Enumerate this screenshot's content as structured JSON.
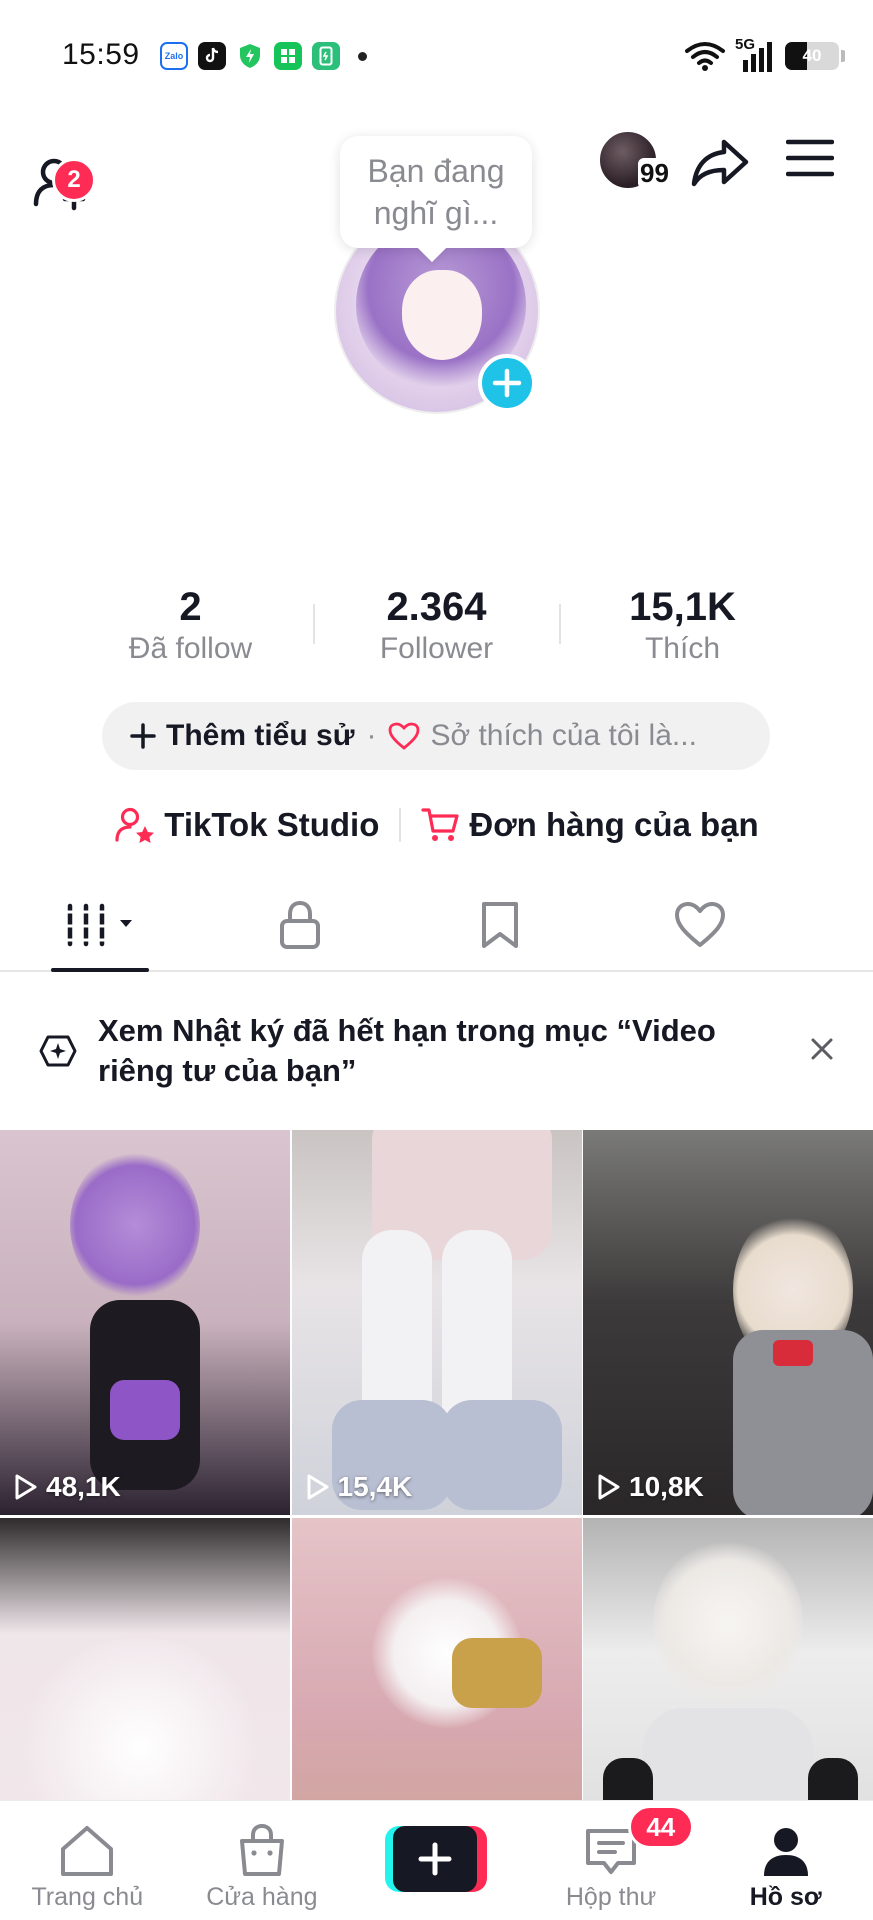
{
  "status_bar": {
    "time": "15:59",
    "network": "5G",
    "battery": "40",
    "notification_icons": [
      "zalo-icon",
      "tiktok-icon",
      "shield-icon",
      "green-app-icon",
      "phone-clean-icon"
    ]
  },
  "header": {
    "friend_badge": "2",
    "stack_count": "99"
  },
  "profile": {
    "thought_bubble": "Bạn đang nghĩ gì..."
  },
  "stats": [
    {
      "value": "2",
      "label": "Đã follow"
    },
    {
      "value": "2.364",
      "label": "Follower"
    },
    {
      "value": "15,1K",
      "label": "Thích"
    }
  ],
  "bio": {
    "add_label": "Thêm tiểu sử",
    "separator": "·",
    "hobby_placeholder": "Sở thích của tôi là..."
  },
  "links": {
    "studio": "TikTok Studio",
    "orders": "Đơn hàng của bạn"
  },
  "banner": {
    "text": "Xem Nhật ký đã hết hạn trong mục “Video riêng tư của bạn”"
  },
  "videos": [
    {
      "views": "48,1K"
    },
    {
      "views": "15,4K"
    },
    {
      "views": "10,8K"
    },
    {
      "views": ""
    },
    {
      "views": ""
    },
    {
      "views": ""
    }
  ],
  "nav": {
    "home": "Trang chủ",
    "shop": "Cửa hàng",
    "inbox": "Hộp thư",
    "inbox_badge": "44",
    "profile": "Hồ sơ"
  },
  "colors": {
    "accent": "#fe2c55",
    "cyan": "#25f4ee",
    "avatar_add": "#20c3e8",
    "text_primary": "#161823",
    "text_secondary": "#8a8b91"
  }
}
